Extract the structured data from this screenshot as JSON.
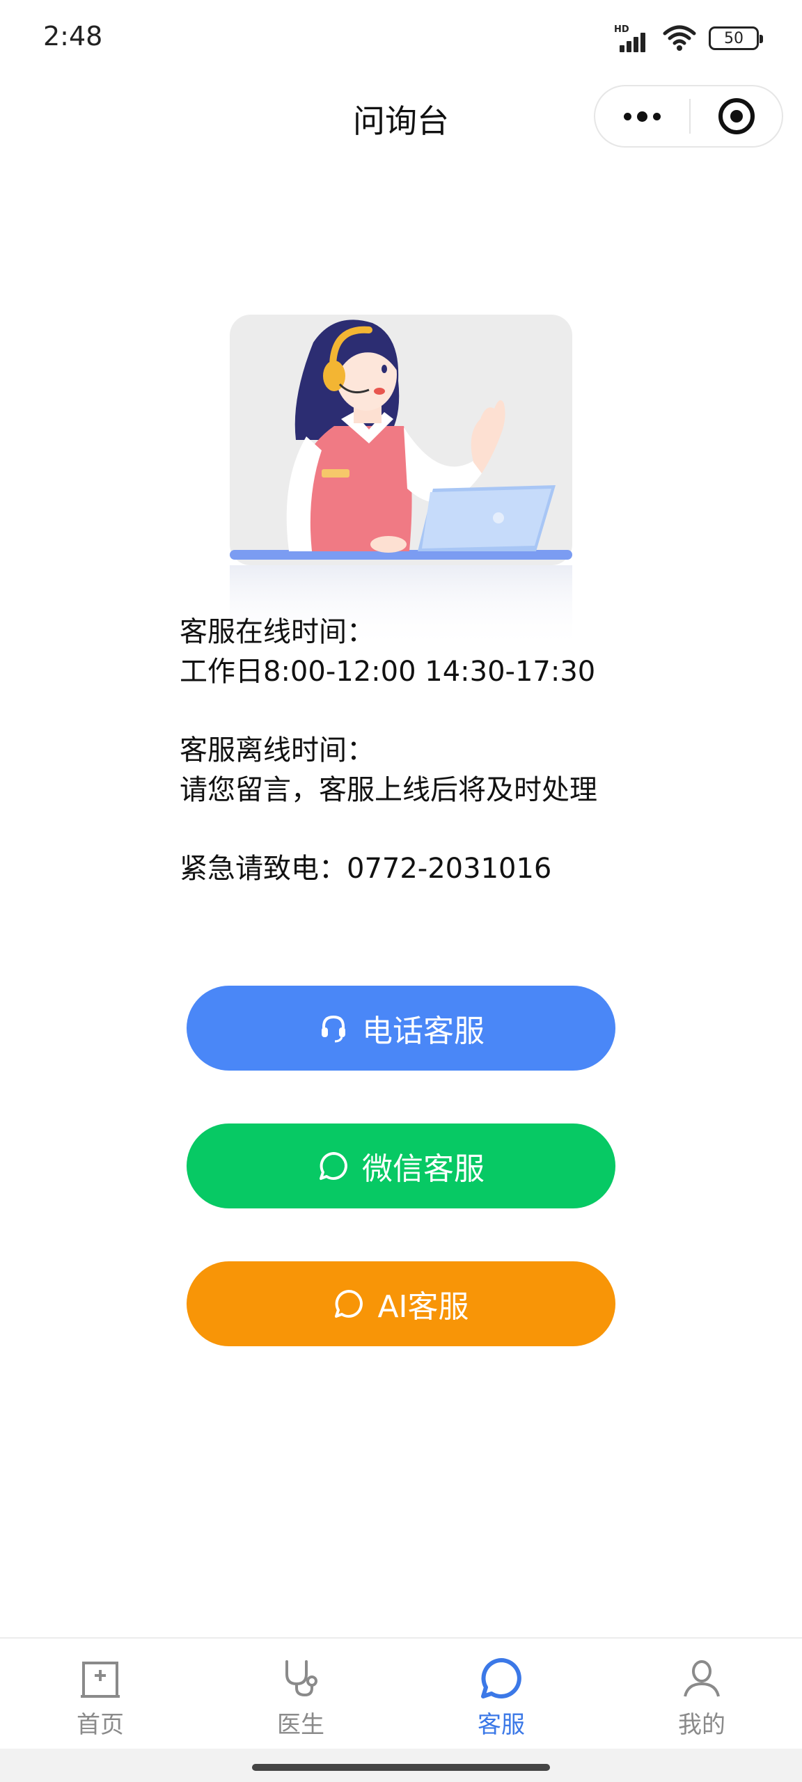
{
  "status_bar": {
    "time": "2:48",
    "network_label": "HD",
    "battery_level": "50"
  },
  "nav": {
    "title": "问询台"
  },
  "info": {
    "online_title": "客服在线时间：",
    "online_hours": "工作日8:00-12:00 14:30-17:30",
    "offline_title": "客服离线时间：",
    "offline_note": "请您留言，客服上线后将及时处理",
    "emergency": "紧急请致电：0772-2031016"
  },
  "buttons": {
    "phone": {
      "label": "电话客服",
      "icon": "headset-icon",
      "color": "#4a87f7"
    },
    "wechat": {
      "label": "微信客服",
      "icon": "chat-bubble-icon",
      "color": "#07c964"
    },
    "ai": {
      "label": "AI客服",
      "icon": "chat-bubble-icon",
      "color": "#f89507"
    }
  },
  "tabbar": {
    "active_color": "#3b78e7",
    "inactive_color": "#8a8a8a",
    "items": [
      {
        "label": "首页",
        "icon": "hospital-icon"
      },
      {
        "label": "医生",
        "icon": "stethoscope-icon"
      },
      {
        "label": "客服",
        "icon": "chat-bubble-icon",
        "active": true
      },
      {
        "label": "我的",
        "icon": "user-icon"
      }
    ]
  }
}
